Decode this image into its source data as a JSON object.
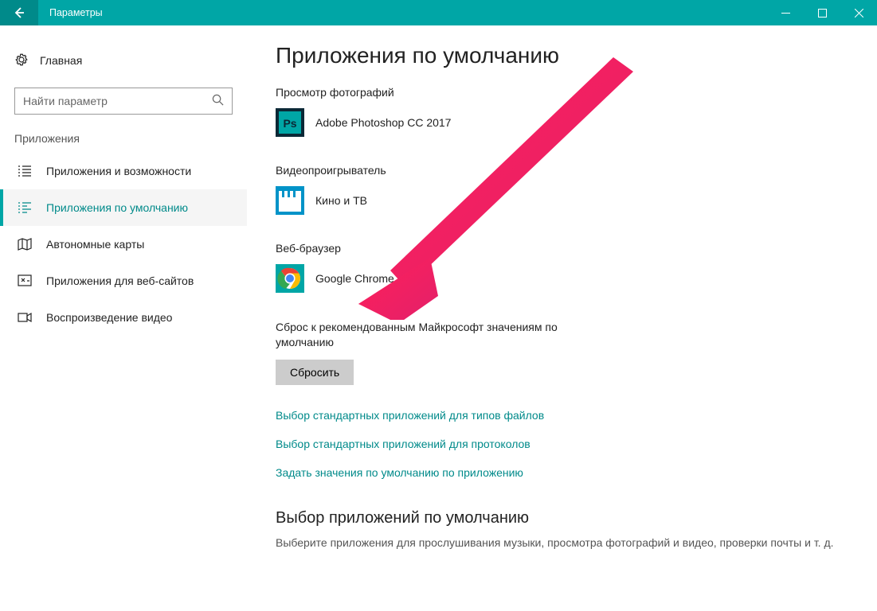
{
  "window": {
    "title": "Параметры"
  },
  "sidebar": {
    "home": {
      "label": "Главная"
    },
    "search": {
      "placeholder": "Найти параметр"
    },
    "group_label": "Приложения",
    "items": [
      {
        "label": "Приложения и возможности"
      },
      {
        "label": "Приложения по умолчанию"
      },
      {
        "label": "Автономные карты"
      },
      {
        "label": "Приложения для веб-сайтов"
      },
      {
        "label": "Воспроизведение видео"
      }
    ],
    "active_index": 1
  },
  "main": {
    "title": "Приложения по умолчанию",
    "sections": [
      {
        "label": "Просмотр фотографий",
        "app": "Adobe Photoshop CC 2017",
        "icon": "photoshop"
      },
      {
        "label": "Видеопроигрыватель",
        "app": "Кино и ТВ",
        "icon": "movies-tv"
      },
      {
        "label": "Веб-браузер",
        "app": "Google Chrome",
        "icon": "chrome"
      }
    ],
    "reset": {
      "text": "Сброс к рекомендованным Майкрософт значениям по умолчанию",
      "button": "Сбросить"
    },
    "links": [
      "Выбор стандартных приложений для типов файлов",
      "Выбор стандартных приложений для протоколов",
      "Задать значения по умолчанию по приложению"
    ],
    "choose": {
      "title": "Выбор приложений по умолчанию",
      "desc": "Выберите приложения для прослушивания музыки, просмотра фотографий и видео, проверки почты и т. д."
    }
  },
  "annotation": {
    "arrow": {
      "color": "#e83e8c",
      "points_to": "web-browser-app"
    }
  }
}
